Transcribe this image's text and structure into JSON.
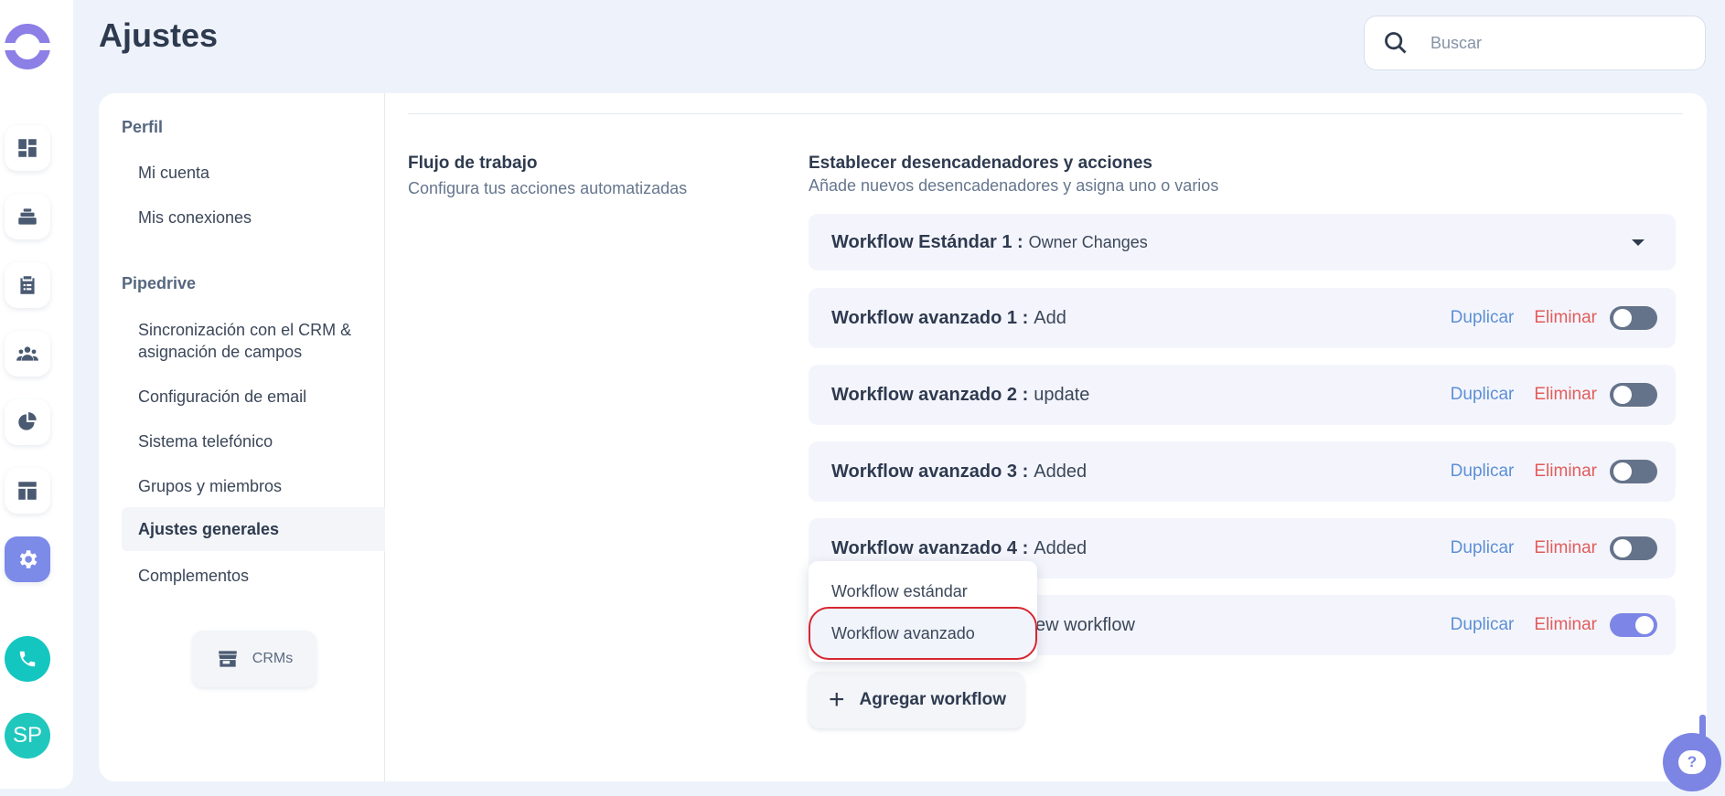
{
  "header": {
    "title": "Ajustes"
  },
  "search": {
    "placeholder": "Buscar"
  },
  "rail": {
    "items": [
      {
        "icon": "dashboard-icon"
      },
      {
        "icon": "layers-icon"
      },
      {
        "icon": "clipboard-icon"
      },
      {
        "icon": "team-icon"
      },
      {
        "icon": "pie-chart-icon"
      },
      {
        "icon": "layout-icon"
      },
      {
        "icon": "gear-icon",
        "active": true
      }
    ],
    "avatar_initials": "SP"
  },
  "settings_nav": {
    "section_profile": "Perfil",
    "profile_items": [
      "Mi cuenta",
      "Mis conexiones"
    ],
    "section_pipedrive": "Pipedrive",
    "pipedrive_items": [
      "Sincronización con el CRM & asignación de campos",
      "Configuración de email",
      "Sistema telefónico",
      "Grupos y miembros",
      "Ajustes generales",
      "Complementos"
    ],
    "active_item": "Ajustes generales",
    "crm_button": "CRMs"
  },
  "content": {
    "left_title": "Flujo de trabajo",
    "left_subtitle": "Configura tus acciones automatizadas",
    "right_title": "Establecer desencadenadores y acciones",
    "right_subtitle": "Añade nuevos desencadenadores y asigna uno o varios",
    "standard_workflow": {
      "name": "Workflow Estándar 1 :",
      "value": "Owner Changes"
    },
    "advanced_workflows": [
      {
        "name": "Workflow avanzado 1 :",
        "value": "Add",
        "enabled": false
      },
      {
        "name": "Workflow avanzado 2 :",
        "value": "update",
        "enabled": false
      },
      {
        "name": "Workflow avanzado 3 :",
        "value": "Added",
        "enabled": false
      },
      {
        "name": "Workflow avanzado 4 :",
        "value": "Added",
        "enabled": false
      },
      {
        "name": "",
        "value": "ew workflow",
        "enabled": true
      }
    ],
    "duplicate_label": "Duplicar",
    "delete_label": "Eliminar",
    "add_button": "Agregar workflow",
    "dropdown_menu": [
      "Workflow estándar",
      "Workflow avanzado"
    ]
  },
  "colors": {
    "accent": "#7c85e3",
    "duplicate": "#5c8fd6",
    "delete": "#e25c5c",
    "highlight_border": "#d7262f"
  }
}
